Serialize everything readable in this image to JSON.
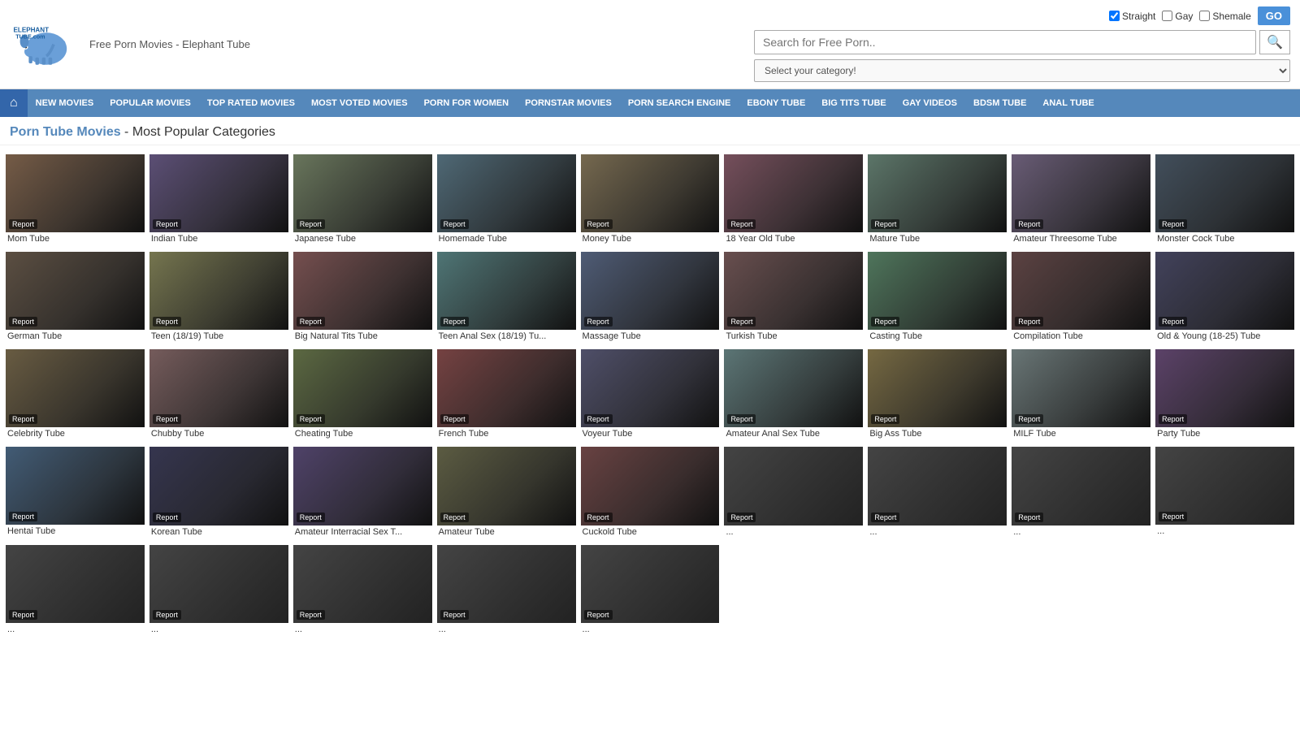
{
  "header": {
    "logo_text": "Free Porn Movies - Elephant Tube",
    "search_placeholder": "Search for Free Porn..",
    "go_label": "GO",
    "search_btn_icon": "🔍",
    "category_default": "Select your category!",
    "top_links": [
      {
        "id": "straight",
        "label": "Straight",
        "checked": true
      },
      {
        "id": "gay",
        "label": "Gay",
        "checked": false
      },
      {
        "id": "shemale",
        "label": "Shemale",
        "checked": false
      }
    ]
  },
  "nav": {
    "home_icon": "⌂",
    "items": [
      {
        "id": "new-movies",
        "label": "NEW MOVIES"
      },
      {
        "id": "popular-movies",
        "label": "POPULAR MOVIES"
      },
      {
        "id": "top-rated-movies",
        "label": "TOP RATED MOVIES"
      },
      {
        "id": "most-voted-movies",
        "label": "MOST VOTED MOVIES"
      },
      {
        "id": "porn-for-women",
        "label": "PORN FOR WOMEN"
      },
      {
        "id": "pornstar-movies",
        "label": "PORNSTAR MOVIES"
      },
      {
        "id": "porn-search-engine",
        "label": "PORN SEARCH ENGINE"
      },
      {
        "id": "ebony-tube",
        "label": "EBONY TUBE"
      },
      {
        "id": "big-tits-tube",
        "label": "BIG TITS TUBE"
      },
      {
        "id": "gay-videos",
        "label": "GAY VIDEOS"
      },
      {
        "id": "bdsm-tube",
        "label": "BDSM TUBE"
      },
      {
        "id": "anal-tube",
        "label": "ANAL TUBE"
      }
    ]
  },
  "page_title": {
    "part1": "Porn Tube Movies",
    "part2": " - Most Popular Categories"
  },
  "categories": [
    {
      "id": "mom-tube",
      "label": "Mom Tube",
      "color": "#8a6a50"
    },
    {
      "id": "indian-tube",
      "label": "Indian Tube",
      "color": "#6a5a8a"
    },
    {
      "id": "japanese-tube",
      "label": "Japanese Tube",
      "color": "#7a8a6a"
    },
    {
      "id": "homemade-tube",
      "label": "Homemade Tube",
      "color": "#5a7a8a"
    },
    {
      "id": "money-tube",
      "label": "Money Tube",
      "color": "#8a7a5a"
    },
    {
      "id": "18-year-old-tube",
      "label": "18 Year Old Tube",
      "color": "#8a5a6a"
    },
    {
      "id": "mature-tube",
      "label": "Mature Tube",
      "color": "#6a8a7a"
    },
    {
      "id": "amateur-threesome-tube",
      "label": "Amateur Threesome Tube",
      "color": "#7a6a8a"
    },
    {
      "id": "monster-cock-tube",
      "label": "Monster Cock Tube",
      "color": "#4a5a6a"
    },
    {
      "id": "german-tube",
      "label": "German Tube",
      "color": "#6a5a4a"
    },
    {
      "id": "teen-tube",
      "label": "Teen (18/19) Tube",
      "color": "#8a8a5a"
    },
    {
      "id": "big-natural-tits-tube",
      "label": "Big Natural Tits Tube",
      "color": "#8a5a5a"
    },
    {
      "id": "teen-anal-sex-tube",
      "label": "Teen Anal Sex (18/19) Tu...",
      "color": "#5a8a8a"
    },
    {
      "id": "massage-tube",
      "label": "Massage Tube",
      "color": "#5a6a8a"
    },
    {
      "id": "turkish-tube",
      "label": "Turkish Tube",
      "color": "#7a5a5a"
    },
    {
      "id": "casting-tube",
      "label": "Casting Tube",
      "color": "#5a8a6a"
    },
    {
      "id": "compilation-tube",
      "label": "Compilation Tube",
      "color": "#6a4a4a"
    },
    {
      "id": "old-young-tube",
      "label": "Old & Young (18-25) Tube",
      "color": "#4a4a6a"
    },
    {
      "id": "celebrity-tube",
      "label": "Celebrity Tube",
      "color": "#7a6a4a"
    },
    {
      "id": "chubby-tube",
      "label": "Chubby Tube",
      "color": "#8a6a6a"
    },
    {
      "id": "cheating-tube",
      "label": "Cheating Tube",
      "color": "#6a7a4a"
    },
    {
      "id": "french-tube",
      "label": "French Tube",
      "color": "#8a4a4a"
    },
    {
      "id": "voyeur-tube",
      "label": "Voyeur Tube",
      "color": "#5a5a7a"
    },
    {
      "id": "amateur-anal-sex-tube",
      "label": "Amateur Anal Sex Tube",
      "color": "#6a8a8a"
    },
    {
      "id": "big-ass-tube",
      "label": "Big Ass Tube",
      "color": "#8a7a4a"
    },
    {
      "id": "milf-tube",
      "label": "MILF Tube",
      "color": "#7a8a8a"
    },
    {
      "id": "party-tube",
      "label": "Party Tube",
      "color": "#6a4a7a"
    },
    {
      "id": "hentai-tube",
      "label": "Hentai Tube",
      "color": "#4a6a8a"
    },
    {
      "id": "korean-tube",
      "label": "Korean Tube",
      "color": "#3a3a5a"
    },
    {
      "id": "amateur-interracial-tube",
      "label": "Amateur Interracial Sex T...",
      "color": "#5a4a7a"
    },
    {
      "id": "amateur-tube",
      "label": "Amateur Tube",
      "color": "#6a6a4a"
    },
    {
      "id": "cuckold-tube",
      "label": "Cuckold Tube",
      "color": "#7a4a4a"
    },
    {
      "id": "cat-33",
      "label": "...",
      "color": "#555"
    },
    {
      "id": "cat-34",
      "label": "...",
      "color": "#445"
    },
    {
      "id": "cat-35",
      "label": "...",
      "color": "#454"
    },
    {
      "id": "cat-36",
      "label": "...",
      "color": "#544"
    },
    {
      "id": "cat-37",
      "label": "...",
      "color": "#455"
    },
    {
      "id": "cat-38",
      "label": "...",
      "color": "#545"
    },
    {
      "id": "cat-39",
      "label": "...",
      "color": "#554"
    },
    {
      "id": "cat-40",
      "label": "...",
      "color": "#456"
    },
    {
      "id": "cat-41",
      "label": "...",
      "color": "#564"
    }
  ],
  "report_label": "Report"
}
